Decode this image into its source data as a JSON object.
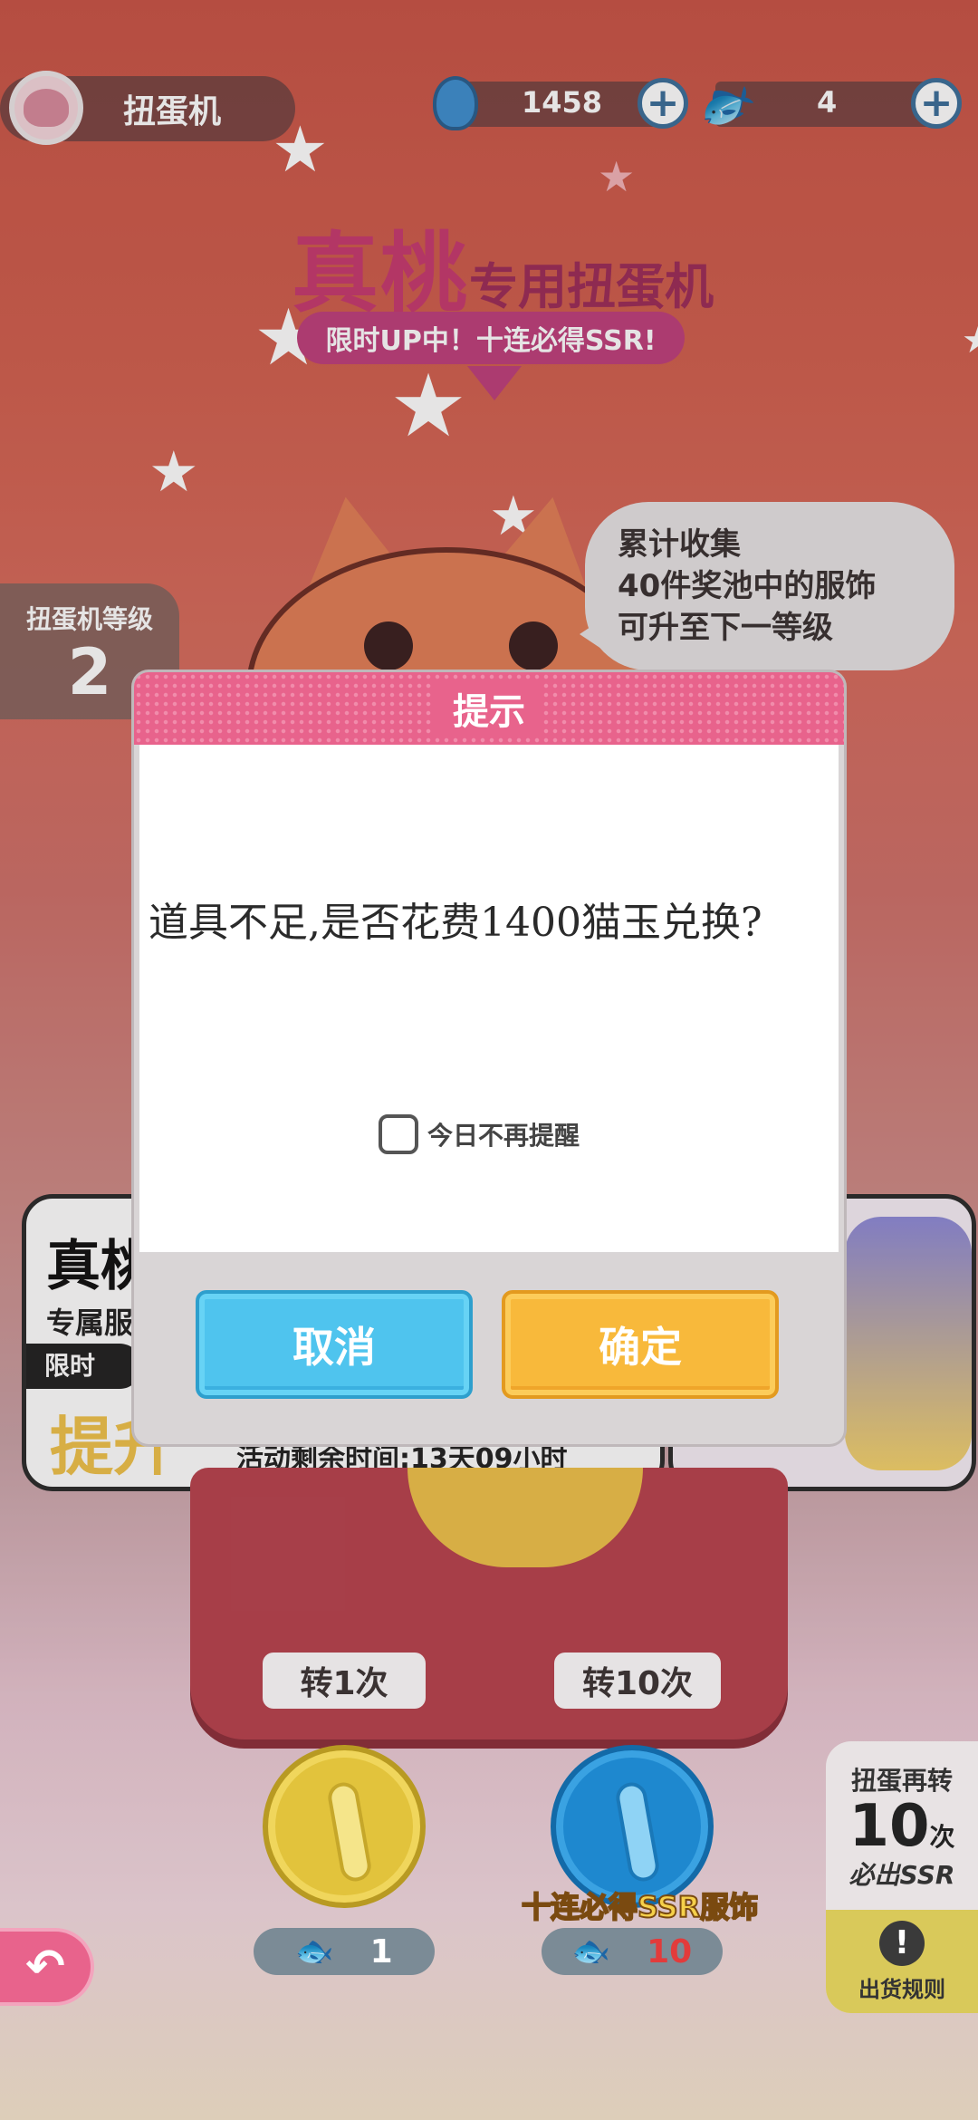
{
  "top_bar": {
    "machine_title": "扭蛋机",
    "gem_count": "1458",
    "fish_count": "4"
  },
  "banner": {
    "title_main": "真桃",
    "title_sub": "专用扭蛋机",
    "promo": "限时UP中！十连必得SSR!"
  },
  "hint_bubble": {
    "line1": "累计收集",
    "line2": "40件奖池中的服饰",
    "line3": "可升至下一等级"
  },
  "level_panel": {
    "label": "扭蛋机等级",
    "value": "2"
  },
  "background_cards": {
    "card1_title": "真桃",
    "card1_sub": "专属服",
    "card1_tag": "限时",
    "card1_big": "提升",
    "card1_timer": "活动剩余时间:13天09小时"
  },
  "dialog": {
    "title": "提示",
    "message": "道具不足,是否花费1400猫玉兑换?",
    "checkbox_label": "今日不再提醒",
    "checkbox_checked": false,
    "cancel_label": "取消",
    "confirm_label": "确定"
  },
  "spins": {
    "single_label": "转1次",
    "single_cost": "1",
    "ten_label": "转10次",
    "ten_cost": "10",
    "ten_promo": "十连必得SSR服饰"
  },
  "side_panel": {
    "line1": "扭蛋再转",
    "count": "10",
    "unit": "次",
    "line3": "必出SSR",
    "rules_label": "出货规则"
  },
  "colors": {
    "accent_pink": "#e8638c",
    "cancel_blue": "#4fc4ee",
    "confirm_orange": "#f8b93b"
  },
  "icons": [
    "avatar-icon",
    "gem-icon",
    "fish-icon",
    "plus-icon",
    "star-icon",
    "back-arrow-icon",
    "exclamation-icon",
    "checkbox-icon"
  ]
}
